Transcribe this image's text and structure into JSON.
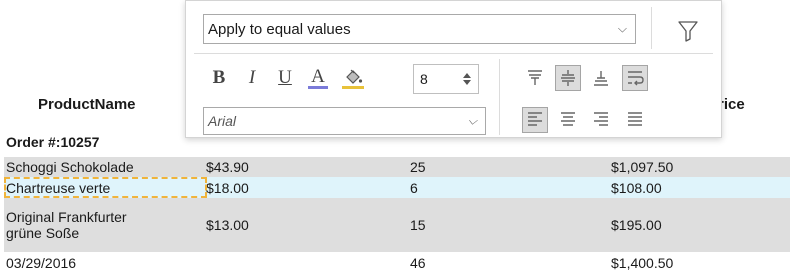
{
  "grid": {
    "headers": {
      "product": "ProductName",
      "price": "Price"
    },
    "group_label": "Order #:10257",
    "rows": [
      {
        "name": "Schoggi Schokolade",
        "price": "$43.90",
        "qty": "25",
        "total": "$1,097.50"
      },
      {
        "name": "Chartreuse verte",
        "price": "$18.00",
        "qty": "6",
        "total": "$108.00"
      },
      {
        "name_line1": "Original Frankfurter",
        "name_line2": "grüne Soße",
        "price": "$13.00",
        "qty": "15",
        "total": "$195.00"
      },
      {
        "name": "03/29/2016",
        "qty": "46",
        "total": "$1,400.50"
      }
    ]
  },
  "toolbar": {
    "condition_select": "Apply to equal values",
    "font_family": "Arial",
    "font_size": "8",
    "bold_label": "B",
    "italic_label": "I",
    "underline_label": "U",
    "font_color_label": "A"
  },
  "colors": {
    "font_color_underline": "#7b7bd9",
    "fill_color_underline": "#e8c23a",
    "selected_row": "#dff4fb",
    "alt_row": "#dedede",
    "focus_border": "#f0b43c"
  },
  "icons": {
    "filter": "filter-icon",
    "fill": "paint-bucket-icon",
    "spinner": "spinner-arrows-icon",
    "valign_top": "align-top-icon",
    "valign_middle": "align-middle-icon",
    "valign_bottom": "align-bottom-icon",
    "wrap": "wrap-text-icon",
    "halign_left": "align-left-icon",
    "halign_center": "align-center-icon",
    "halign_right": "align-right-icon",
    "halign_justify": "align-justify-icon"
  },
  "state": {
    "active_vertical_align": "middle",
    "wrap_text": true,
    "active_horizontal_align": "left"
  }
}
